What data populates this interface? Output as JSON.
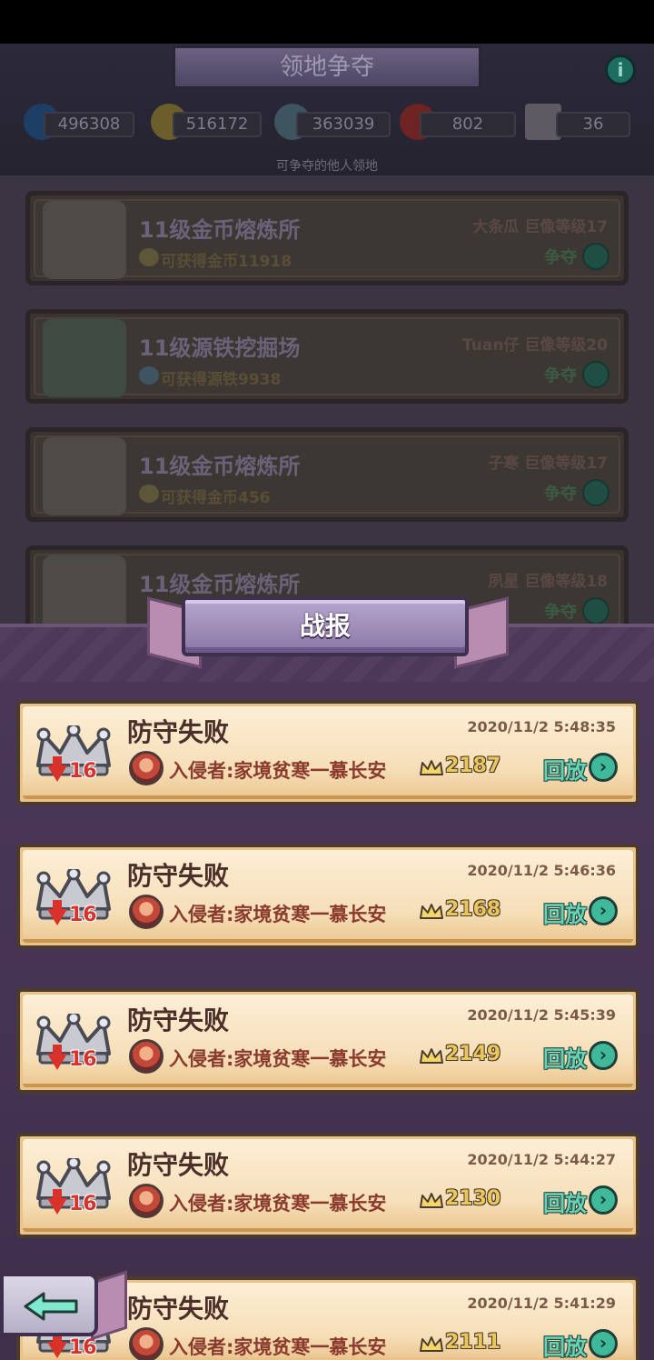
{
  "background": {
    "title": "领地争夺",
    "resources": [
      {
        "icon": "water-drop-icon",
        "value": "496308"
      },
      {
        "icon": "gold-coin-icon",
        "value": "516172"
      },
      {
        "icon": "source-iron-icon",
        "value": "363039"
      },
      {
        "icon": "dumbbell-icon",
        "value": "802"
      },
      {
        "icon": "card-ticket-icon",
        "value": "36"
      }
    ],
    "subtitle": "可争夺的他人领地",
    "territories": [
      {
        "name": "11级金币熔炼所",
        "gain": "可获得金币11918",
        "owner": "大条瓜  巨像等级17",
        "action": "争夺"
      },
      {
        "name": "11级源铁挖掘场",
        "gain": "可获得源铁9938",
        "owner": "Tuan仔  巨像等级20",
        "action": "争夺"
      },
      {
        "name": "11级金币熔炼所",
        "gain": "可获得金币456",
        "owner": "子寒  巨像等级17",
        "action": "争夺"
      },
      {
        "name": "11级金币熔炼所",
        "gain": "",
        "owner": "夙星  巨像等级18",
        "action": "争夺"
      }
    ]
  },
  "panel": {
    "title": "战报",
    "reports": [
      {
        "result": "防守失败",
        "time": "2020/11/2 5:48:35",
        "trophy_loss": "16",
        "invader": "入侵者:家境贫寒一慕长安",
        "trophies": "2187",
        "replay": "回放"
      },
      {
        "result": "防守失败",
        "time": "2020/11/2 5:46:36",
        "trophy_loss": "16",
        "invader": "入侵者:家境贫寒一慕长安",
        "trophies": "2168",
        "replay": "回放"
      },
      {
        "result": "防守失败",
        "time": "2020/11/2 5:45:39",
        "trophy_loss": "16",
        "invader": "入侵者:家境贫寒一慕长安",
        "trophies": "2149",
        "replay": "回放"
      },
      {
        "result": "防守失败",
        "time": "2020/11/2 5:44:27",
        "trophy_loss": "16",
        "invader": "入侵者:家境贫寒一慕长安",
        "trophies": "2130",
        "replay": "回放"
      },
      {
        "result": "防守失败",
        "time": "2020/11/2 5:41:29",
        "trophy_loss": "16",
        "invader": "入侵者:家境贫寒一慕长安",
        "trophies": "2111",
        "replay": "回放"
      }
    ]
  },
  "back_button_icon": "back-arrow-icon"
}
